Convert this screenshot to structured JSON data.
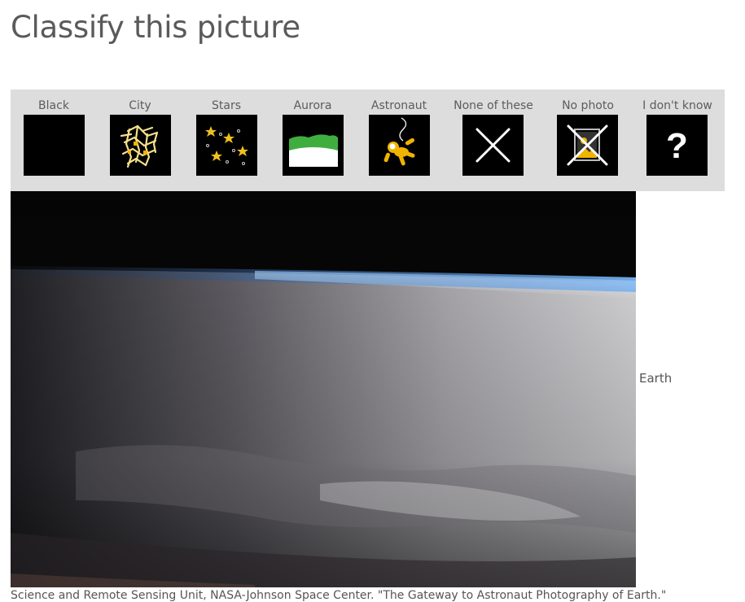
{
  "page": {
    "title": "Classify this picture"
  },
  "choices": [
    {
      "label": "Black",
      "icon": "black-square-icon"
    },
    {
      "label": "City",
      "icon": "city-lights-icon"
    },
    {
      "label": "Stars",
      "icon": "stars-icon"
    },
    {
      "label": "Aurora",
      "icon": "aurora-icon"
    },
    {
      "label": "Astronaut",
      "icon": "astronaut-icon"
    },
    {
      "label": "None of these",
      "icon": "x-mark-icon"
    },
    {
      "label": "No photo",
      "icon": "no-photo-icon"
    },
    {
      "label": "I don't know",
      "icon": "question-mark-icon"
    }
  ],
  "photo": {
    "label": "Earth",
    "subject": "earth-limb-from-orbit"
  },
  "credit": "Science and Remote Sensing Unit, NASA-Johnson Space Center. \"The Gateway to Astronaut Photography of Earth.\"",
  "colors": {
    "panel": "#dddddd",
    "icon_bg": "#000000",
    "accent_gold": "#f0b400",
    "aurora_green": "#3fae3f",
    "text": "#555555"
  }
}
